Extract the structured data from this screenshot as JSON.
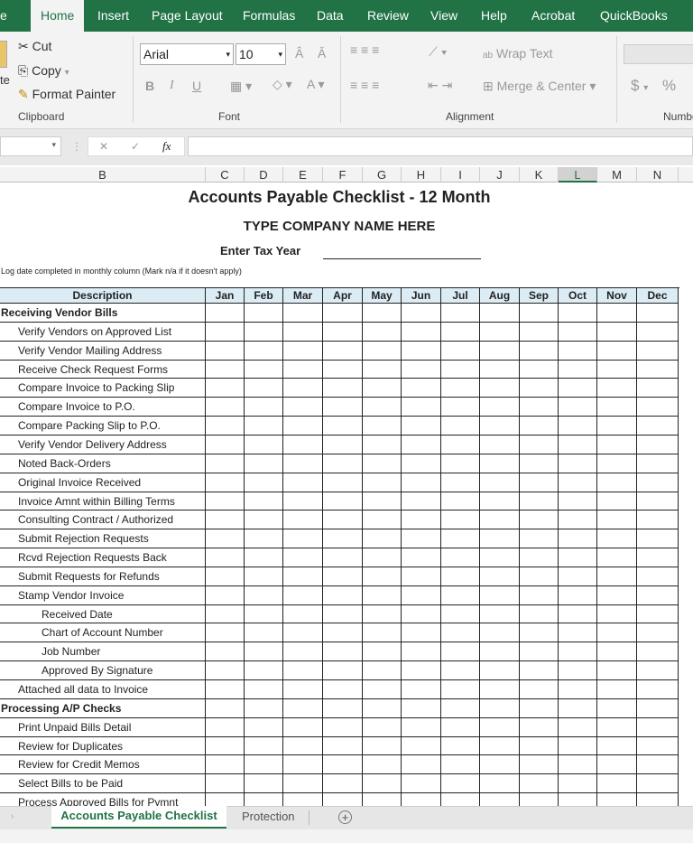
{
  "ribbon_tabs": [
    "e",
    "Home",
    "Insert",
    "Page Layout",
    "Formulas",
    "Data",
    "Review",
    "View",
    "Help",
    "Acrobat",
    "QuickBooks"
  ],
  "active_tab": "Home",
  "clipboard": {
    "cut": "Cut",
    "copy": "Copy",
    "format_painter": "Format Painter",
    "paste_partial": "te",
    "group": "Clipboard"
  },
  "font": {
    "name": "Arial",
    "size": "10",
    "group": "Font",
    "bold": "B",
    "italic": "I",
    "underline": "U"
  },
  "alignment": {
    "wrap": "Wrap Text",
    "merge": "Merge & Center",
    "group": "Alignment"
  },
  "number": {
    "currency": "$",
    "percent": "%",
    "group": "Numbe"
  },
  "formula_bar": {
    "fx": "fx",
    "cancel": "✕",
    "enter": "✓",
    "value": ""
  },
  "columns": [
    "B",
    "C",
    "D",
    "E",
    "F",
    "G",
    "H",
    "I",
    "J",
    "K",
    "L",
    "M",
    "N"
  ],
  "selected_column": "L",
  "sheet": {
    "title": "Accounts Payable Checklist - 12 Month",
    "company": "TYPE COMPANY NAME HERE",
    "tax_year_label": "Enter Tax Year",
    "instruction": "Log date completed in monthly column (Mark n/a if it doesn't apply)",
    "header_desc": "Description",
    "months": [
      "Jan",
      "Feb",
      "Mar",
      "Apr",
      "May",
      "Jun",
      "Jul",
      "Aug",
      "Sep",
      "Oct",
      "Nov",
      "Dec"
    ],
    "rows": [
      {
        "text": "Receiving Vendor Bills",
        "level": 0
      },
      {
        "text": "Verify Vendors on Approved List",
        "level": 1
      },
      {
        "text": "Verify Vendor Mailing Address",
        "level": 1
      },
      {
        "text": "Receive Check Request Forms",
        "level": 1
      },
      {
        "text": "Compare Invoice to Packing Slip",
        "level": 1
      },
      {
        "text": "Compare Invoice to P.O.",
        "level": 1
      },
      {
        "text": "Compare Packing Slip to P.O.",
        "level": 1
      },
      {
        "text": "Verify Vendor Delivery Address",
        "level": 1
      },
      {
        "text": "Noted Back-Orders",
        "level": 1
      },
      {
        "text": "Original Invoice Received",
        "level": 1
      },
      {
        "text": "Invoice Amnt within Billing Terms",
        "level": 1
      },
      {
        "text": "Consulting Contract / Authorized",
        "level": 1
      },
      {
        "text": "Submit Rejection Requests",
        "level": 1
      },
      {
        "text": "Rcvd Rejection Requests Back",
        "level": 1
      },
      {
        "text": "Submit Requests for Refunds",
        "level": 1
      },
      {
        "text": "Stamp Vendor Invoice",
        "level": 1
      },
      {
        "text": "Received Date",
        "level": 2
      },
      {
        "text": "Chart of Account Number",
        "level": 2
      },
      {
        "text": "Job Number",
        "level": 2
      },
      {
        "text": "Approved By Signature",
        "level": 2
      },
      {
        "text": "Attached all data to Invoice",
        "level": 1
      },
      {
        "text": "Processing A/P Checks",
        "level": 0
      },
      {
        "text": "Print Unpaid Bills Detail",
        "level": 1
      },
      {
        "text": "Review for Duplicates",
        "level": 1
      },
      {
        "text": "Review for Credit Memos",
        "level": 1
      },
      {
        "text": "Select Bills to be Paid",
        "level": 1
      },
      {
        "text": "Process Approved Bills for Pymnt",
        "level": 1
      }
    ]
  },
  "sheet_tabs": [
    "Accounts Payable Checklist",
    "Protection"
  ],
  "active_sheet": "Accounts Payable Checklist",
  "colors": {
    "accent": "#217346",
    "header_fill": "#dcecf5"
  }
}
